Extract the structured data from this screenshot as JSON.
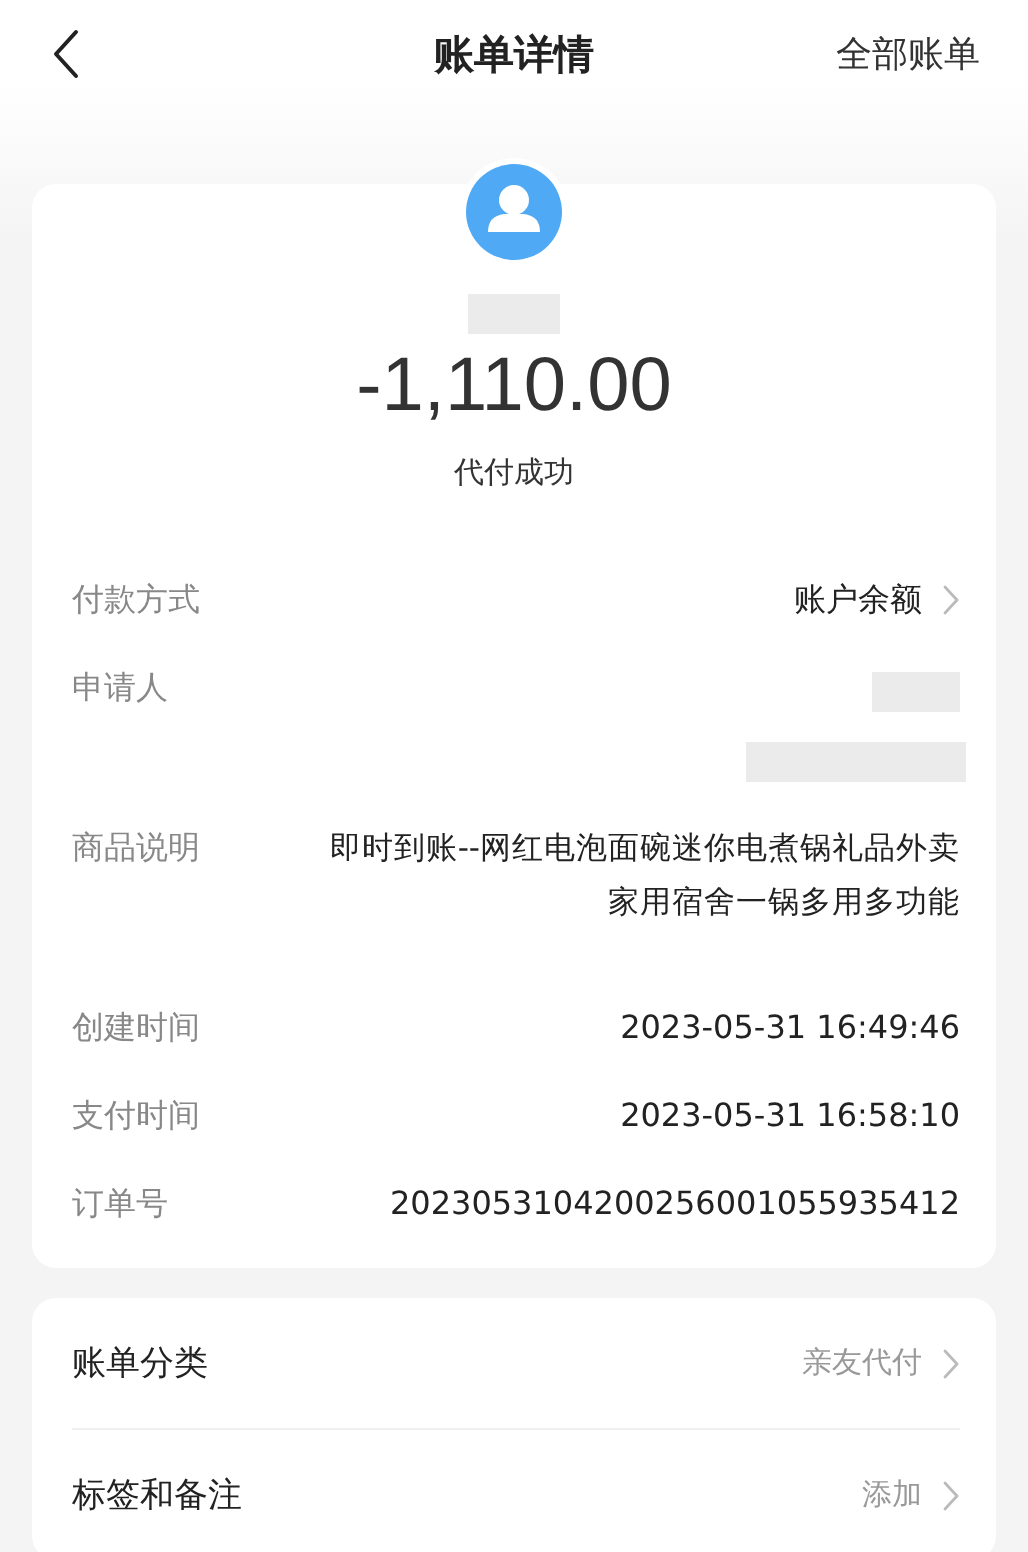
{
  "header": {
    "title": "账单详情",
    "action": "全部账单"
  },
  "summary": {
    "name_redacted": true,
    "amount": "-1,110.00",
    "status": "代付成功"
  },
  "details": [
    {
      "kind": "link",
      "label": "付款方式",
      "value": "账户余额"
    },
    {
      "kind": "redacted",
      "label": "申请人"
    },
    {
      "kind": "multiline",
      "label": "商品说明",
      "lines": [
        "即时到账--网红电泡面碗迷你电煮锅礼品外卖",
        "家用宿舍一锅多用多功能"
      ]
    },
    {
      "kind": "text",
      "label": "创建时间",
      "value": "2023-05-31 16:49:46"
    },
    {
      "kind": "text",
      "label": "支付时间",
      "value": "2023-05-31 16:58:10"
    },
    {
      "kind": "text",
      "label": "订单号",
      "value": "2023053104200256001055935412"
    }
  ],
  "settings": [
    {
      "label": "账单分类",
      "value": "亲友代付"
    },
    {
      "label": "标签和备注",
      "value": "添加"
    }
  ]
}
